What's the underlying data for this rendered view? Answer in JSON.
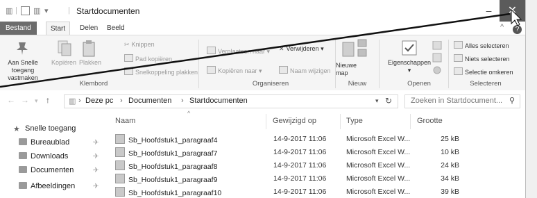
{
  "window": {
    "title": "Startdocumenten",
    "minimize": "–",
    "maximize": "☐",
    "close": "✕"
  },
  "tabs": {
    "file": "Bestand",
    "start": "Start",
    "share": "Delen",
    "view": "Beeld"
  },
  "ribbon": {
    "clipboard": {
      "pin": "Aan Snelle toegang vastmaken",
      "copy": "Kopiëren",
      "paste": "Plakken",
      "cut": "Knippen",
      "copy_path": "Pad kopiëren",
      "paste_shortcut": "Snelkoppeling plakken",
      "label": "Klembord"
    },
    "organize": {
      "move_to": "Verplaatsen naar ▾",
      "copy_to": "Kopiëren naar ▾",
      "delete": "Verwijderen ▾",
      "rename": "Naam wijzigen",
      "label": "Organiseren"
    },
    "new": {
      "new_folder": "Nieuwe map",
      "label": "Nieuw"
    },
    "open": {
      "properties": "Eigenschappen",
      "label": "Openen"
    },
    "select": {
      "select_all": "Alles selecteren",
      "select_none": "Niets selecteren",
      "invert": "Selectie omkeren",
      "label": "Selecteren"
    }
  },
  "address": {
    "breadcrumb": [
      "Deze pc",
      "Documenten",
      "Startdocumenten"
    ],
    "search_placeholder": "Zoeken in Startdocument..."
  },
  "nav": {
    "items": [
      {
        "label": "Snelle toegang"
      },
      {
        "label": "Bureaublad"
      },
      {
        "label": "Downloads"
      },
      {
        "label": "Documenten"
      },
      {
        "label": "Afbeeldingen"
      }
    ]
  },
  "columns": {
    "name": "Naam",
    "modified": "Gewijzigd op",
    "type": "Type",
    "size": "Grootte"
  },
  "files": [
    {
      "name": "Sb_Hoofdstuk1_paragraaf4",
      "modified": "14-9-2017 11:06",
      "type": "Microsoft Excel W...",
      "size": "25 kB"
    },
    {
      "name": "Sb_Hoofdstuk1_paragraaf7",
      "modified": "14-9-2017 11:06",
      "type": "Microsoft Excel W...",
      "size": "10 kB"
    },
    {
      "name": "Sb_Hoofdstuk1_paragraaf8",
      "modified": "14-9-2017 11:06",
      "type": "Microsoft Excel W...",
      "size": "24 kB"
    },
    {
      "name": "Sb_Hoofdstuk1_paragraaf9",
      "modified": "14-9-2017 11:06",
      "type": "Microsoft Excel W...",
      "size": "34 kB"
    },
    {
      "name": "Sb_Hoofdstuk1_paragraaf10",
      "modified": "14-9-2017 11:06",
      "type": "Microsoft Excel W...",
      "size": "39 kB"
    }
  ]
}
